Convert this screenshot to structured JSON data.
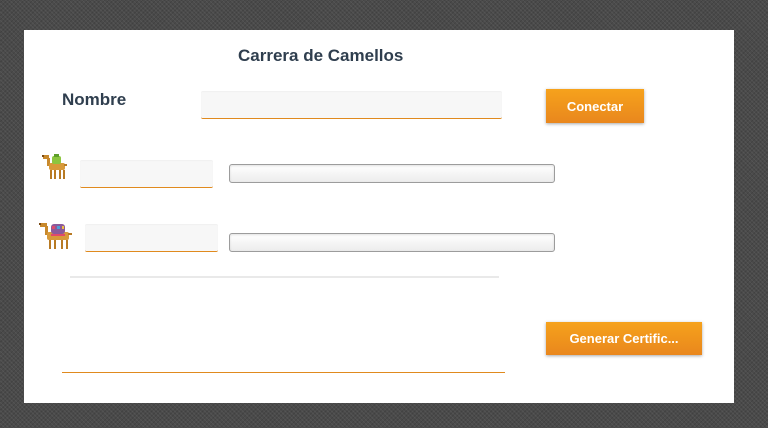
{
  "app": {
    "title": "Carrera de Camellos"
  },
  "login": {
    "name_label": "Nombre",
    "name_value": "",
    "connect_label": "Conectar"
  },
  "racers": [
    {
      "icon": "camel-green-icon",
      "name_value": "",
      "progress": 0
    },
    {
      "icon": "camel-decorated-icon",
      "name_value": "",
      "progress": 0
    }
  ],
  "certificate": {
    "text_value": "",
    "generate_label": "Generar Certific..."
  },
  "colors": {
    "accent": "#f39a1e",
    "title_text": "#2f3e4e",
    "field_bg": "#f7f7f7"
  }
}
